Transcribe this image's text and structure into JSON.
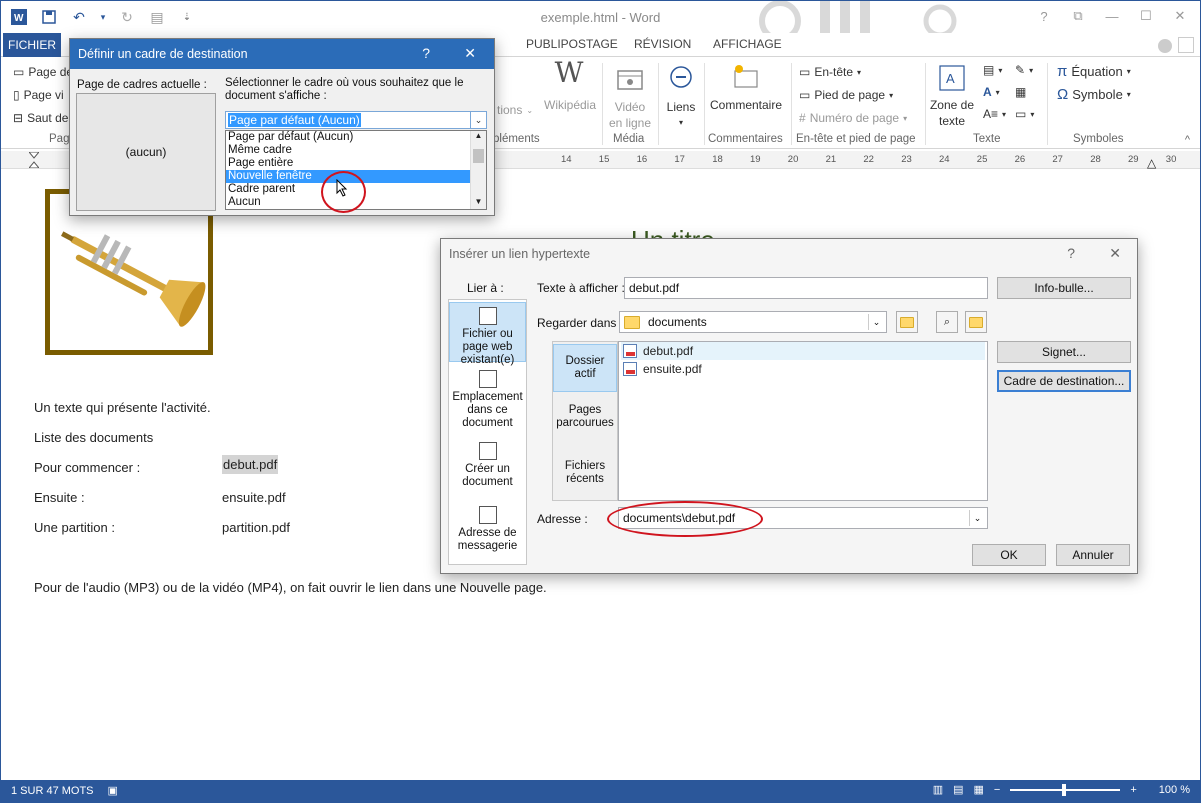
{
  "window": {
    "title": "exemple.html - Word",
    "help": "?",
    "controls": {
      "restore": "⧉",
      "minimize": "—",
      "maximize": "☐",
      "close": "✕"
    }
  },
  "qat": {
    "undo_arrow": "▾",
    "customize": "⇣"
  },
  "tabs": {
    "file": "FICHIER",
    "publipostage": "PUBLIPOSTAGE",
    "revision": "RÉVISION",
    "affichage": "AFFICHAGE"
  },
  "ribbon": {
    "left_items": [
      "Page de",
      "Page vi",
      "Saut de"
    ],
    "left_group": "Pag",
    "apps_label": "tions",
    "complements_group": "pléments",
    "wikipedia": "Wikipédia",
    "video": [
      "Vidéo",
      "en ligne"
    ],
    "media_group": "Média",
    "liens": "Liens",
    "commentaire": "Commentaire",
    "comments_group": "Commentaires",
    "entete": "En-tête",
    "pied": "Pied de page",
    "numero": "Numéro de page",
    "header_group": "En-tête et pied de page",
    "zone_texte": [
      "Zone de",
      "texte"
    ],
    "texte_group": "Texte",
    "equation": "Équation",
    "symbole": "Symbole",
    "symbols_group": "Symboles",
    "collapse": "^"
  },
  "ruler": {
    "ticks": [
      "14",
      "15",
      "16",
      "17",
      "18",
      "19",
      "20",
      "21",
      "22",
      "23",
      "24",
      "25",
      "26",
      "27",
      "28",
      "29",
      "30"
    ]
  },
  "document": {
    "title": "Un titre",
    "lines": [
      "Un texte qui présente l'activité.",
      "Liste des documents"
    ],
    "rows": [
      {
        "label": "Pour commencer :",
        "value": "debut.pdf"
      },
      {
        "label": "Ensuite :",
        "value": "ensuite.pdf"
      },
      {
        "label": "Une partition :",
        "value": "partition.pdf"
      }
    ],
    "footer": "Pour de l'audio (MP3) ou de la vidéo (MP4), on fait ouvrir le lien dans une Nouvelle page."
  },
  "frame_dialog": {
    "title": "Définir un cadre de destination",
    "help": "?",
    "close": "✕",
    "current_label": "Page de cadres actuelle :",
    "preview_text": "(aucun)",
    "select_label": "Sélectionner le cadre où vous souhaitez que le document s'affiche :",
    "selected": "Page par défaut (Aucun)",
    "options": [
      "Page par défaut (Aucun)",
      "Même cadre",
      "Page entière",
      "Nouvelle fenêtre",
      "Cadre parent",
      "Aucun"
    ],
    "active_option": "Nouvelle fenêtre"
  },
  "link_dialog": {
    "title": "Insérer un lien hypertexte",
    "help": "?",
    "close": "✕",
    "link_to_label": "Lier à :",
    "link_to": [
      {
        "label": "Fichier ou page web existant(e)"
      },
      {
        "label": "Emplacement dans ce document"
      },
      {
        "label": "Créer un document"
      },
      {
        "label": "Adresse de messagerie"
      }
    ],
    "text_label": "Texte à afficher :",
    "text_value": "debut.pdf",
    "tooltip_btn": "Info-bulle...",
    "lookin_label": "Regarder dans :",
    "lookin_value": "documents",
    "sides": [
      "Dossier actif",
      "Pages parcourues",
      "Fichiers récents"
    ],
    "files": [
      "debut.pdf",
      "ensuite.pdf"
    ],
    "signet_btn": "Signet...",
    "target_btn": "Cadre de destination...",
    "address_label": "Adresse :",
    "address_value": "documents\\debut.pdf",
    "ok": "OK",
    "cancel": "Annuler"
  },
  "statusbar": {
    "words": "1 SUR 47 MOTS",
    "zoom": "100 %"
  },
  "colors": {
    "word_blue": "#2b579a",
    "dialog_title_blue": "#2b6cb8",
    "selection": "#3399ff",
    "annotation_red": "#d0141e"
  }
}
